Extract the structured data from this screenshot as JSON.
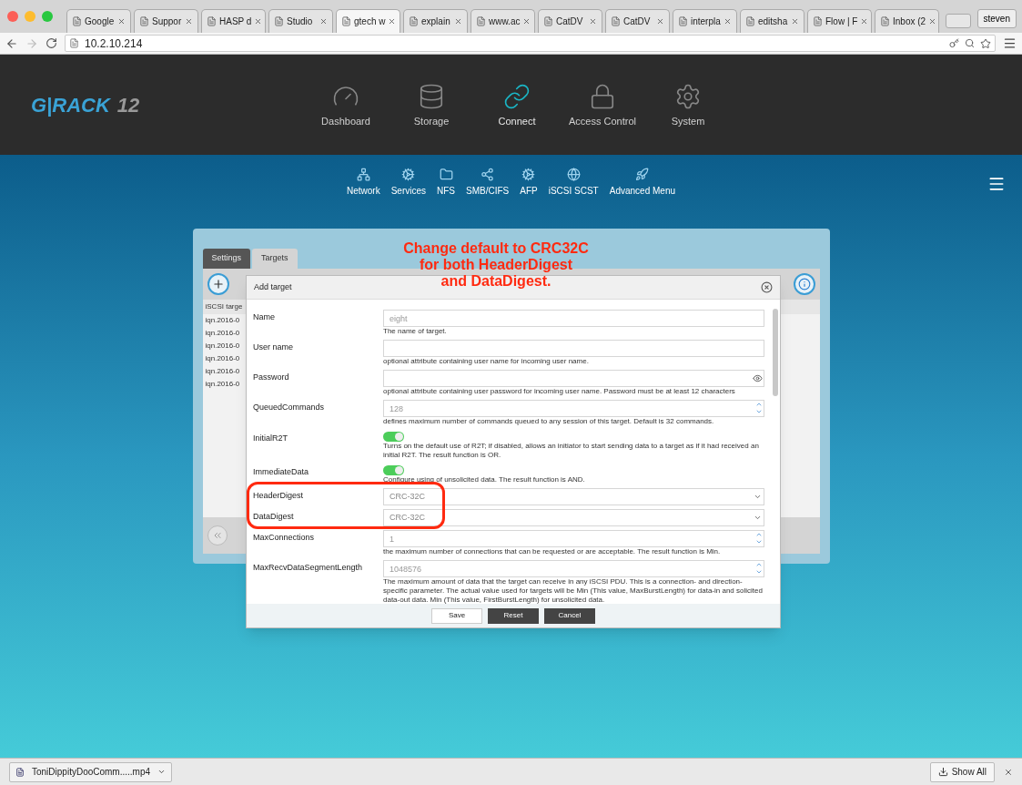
{
  "browser": {
    "tabs": [
      {
        "title": "Google",
        "selected": false
      },
      {
        "title": "Suppor",
        "selected": false
      },
      {
        "title": "HASP d",
        "selected": false
      },
      {
        "title": "Studio",
        "selected": false
      },
      {
        "title": "gtech w",
        "selected": true
      },
      {
        "title": "explain",
        "selected": false
      },
      {
        "title": "www.ac",
        "selected": false
      },
      {
        "title": "CatDV",
        "selected": false
      },
      {
        "title": "CatDV",
        "selected": false
      },
      {
        "title": "interpla",
        "selected": false
      },
      {
        "title": "editsha",
        "selected": false
      },
      {
        "title": "Flow | F",
        "selected": false
      },
      {
        "title": "Inbox (2",
        "selected": false
      }
    ],
    "profile": "steven",
    "url": "10.2.10.214"
  },
  "app": {
    "logo": {
      "brand": "G|RACK",
      "edition": "12"
    },
    "main_nav": [
      {
        "label": "Dashboard",
        "kind": "gauge",
        "selected": false
      },
      {
        "label": "Storage",
        "kind": "database",
        "selected": false
      },
      {
        "label": "Connect",
        "kind": "link",
        "selected": true
      },
      {
        "label": "Access Control",
        "kind": "lock",
        "selected": false
      },
      {
        "label": "System",
        "kind": "gear",
        "selected": false
      }
    ],
    "sub_nav": [
      {
        "label": "Network",
        "kind": "network"
      },
      {
        "label": "Services",
        "kind": "cogs"
      },
      {
        "label": "NFS",
        "kind": "folder"
      },
      {
        "label": "SMB/CIFS",
        "kind": "share"
      },
      {
        "label": "AFP",
        "kind": "cogs"
      },
      {
        "label": "iSCSI SCST",
        "kind": "globe"
      },
      {
        "label": "Advanced Menu",
        "kind": "rocket"
      }
    ]
  },
  "panel": {
    "tabs": [
      {
        "label": "Settings",
        "selected": false
      },
      {
        "label": "Targets",
        "selected": true
      }
    ],
    "list": {
      "header": "iSCSI targe",
      "rows": [
        "iqn.2016-0",
        "iqn.2016-0",
        "iqn.2016-0",
        "iqn.2016-0",
        "iqn.2016-0",
        "iqn.2016-0"
      ]
    }
  },
  "dialog": {
    "title": "Add target",
    "fields": [
      {
        "kind": "text",
        "label": "Name",
        "placeholder": "eight",
        "help": "The name of target."
      },
      {
        "kind": "text",
        "label": "User name",
        "help": "optional attribute containing user name for incoming user name."
      },
      {
        "kind": "password",
        "label": "Password",
        "help": "optional attribute containing user password for incoming user name. Password must be at least 12 characters"
      },
      {
        "kind": "number",
        "label": "QueuedCommands",
        "placeholder": "128",
        "help": "defines maximum number of commands queued to any session of this target. Default is 32 commands."
      },
      {
        "kind": "toggle",
        "label": "InitialR2T",
        "on": true,
        "help": "Turns on the default use of R2T; if disabled, allows an initiator to start sending data to a target as if it had received an initial R2T. The result function is OR."
      },
      {
        "kind": "toggle",
        "label": "ImmediateData",
        "on": true,
        "help": "Configure using of unsolicited data. The result function is AND."
      },
      {
        "kind": "select",
        "label": "HeaderDigest",
        "value": "CRC-32C"
      },
      {
        "kind": "select",
        "label": "DataDigest",
        "value": "CRC-32C"
      },
      {
        "kind": "number",
        "label": "MaxConnections",
        "placeholder": "1",
        "help": "the maximum number of connections that can be requested or are acceptable. The result function is Min."
      },
      {
        "kind": "number",
        "label": "MaxRecvDataSegmentLength",
        "placeholder": "1048576",
        "help": "The maximum amount of data that the target can receive in any iSCSI PDU. This is a connection- and direction-specific parameter. The actual value used for targets will be Min (This value, MaxBurstLength) for data-in and solicited data-out data. Min (This value, FirstBurstLength) for unsolicited data."
      }
    ],
    "buttons": [
      {
        "label": "Save",
        "kind": "light"
      },
      {
        "label": "Reset",
        "kind": "dark"
      },
      {
        "label": "Cancel",
        "kind": "dark"
      }
    ]
  },
  "annotation": [
    "Change default to CRC32C",
    "for both HeaderDigest",
    "and DataDigest."
  ],
  "downloads": {
    "file": "ToniDippityDooComm.....mp4",
    "show_all": "Show All"
  }
}
